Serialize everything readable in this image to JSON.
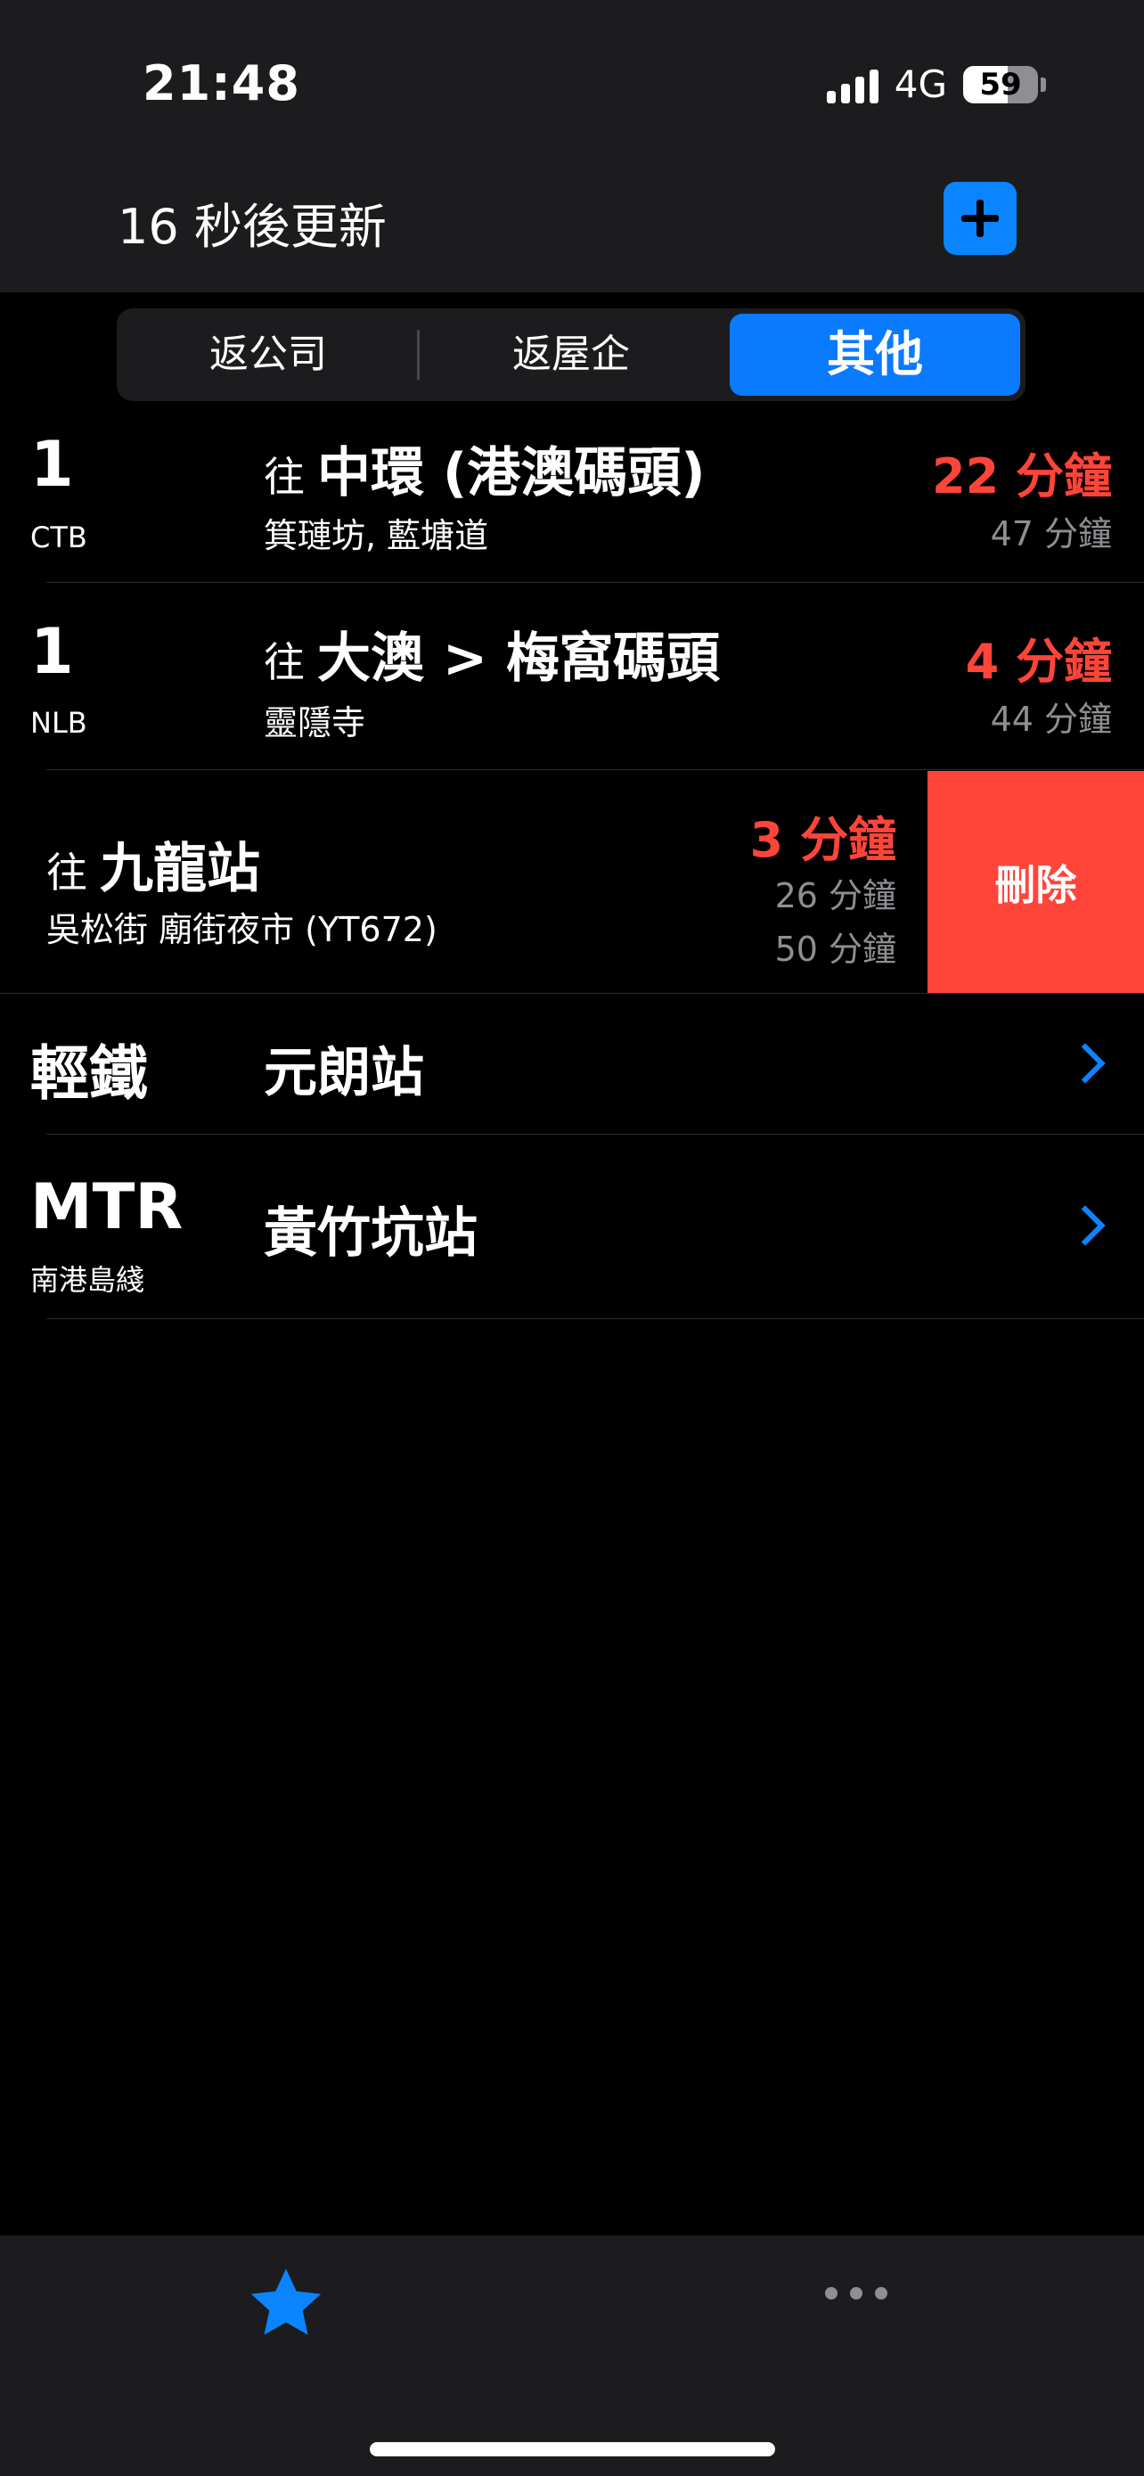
{
  "status_bar": {
    "time": "21:48",
    "network": "4G",
    "battery": "59",
    "battery_level": 0.59
  },
  "header": {
    "refresh_text": "16 秒後更新",
    "add_icon": "plus-icon"
  },
  "segments": [
    {
      "label": "返公司",
      "selected": false
    },
    {
      "label": "返屋企",
      "selected": false
    },
    {
      "label": "其他",
      "selected": true
    }
  ],
  "rows": [
    {
      "route": "1",
      "company": "CTB",
      "to": "往",
      "destination": "中環 (港澳碼頭)",
      "stop": "箕璉坊, 藍塘道",
      "eta_main": "22 分鐘",
      "eta_others": [
        "47 分鐘"
      ]
    },
    {
      "route": "1",
      "company": "NLB",
      "to": "往",
      "destination": "大澳 > 梅窩碼頭",
      "stop": "靈隱寺",
      "eta_main": "4 分鐘",
      "eta_others": [
        "44 分鐘"
      ]
    },
    {
      "route": "",
      "company": "",
      "to": "往",
      "destination": "九龍站",
      "stop": "吳松街 廟街夜市 (YT672)",
      "eta_main": "3 分鐘",
      "eta_others": [
        "26 分鐘",
        "50 分鐘"
      ],
      "delete_label": "刪除"
    }
  ],
  "stations": [
    {
      "type": "輕鐵",
      "subtitle": "",
      "name": "元朗站"
    },
    {
      "type": "MTR",
      "subtitle": "南港島綫",
      "name": "黃竹坑站"
    }
  ],
  "tabbar": {
    "favorites_icon": "star-icon",
    "more_icon": "more-icon"
  },
  "colors": {
    "accent": "#0a84ff",
    "eta": "#ff453a",
    "delete": "#ff453a"
  }
}
